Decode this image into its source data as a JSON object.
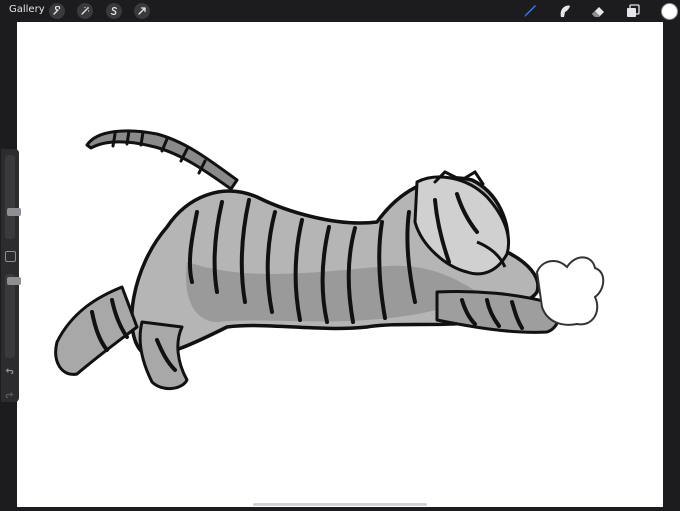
{
  "topbar": {
    "gallery_label": "Gallery",
    "left_tools": [
      {
        "name": "actions-wrench-icon"
      },
      {
        "name": "adjustments-magic-wand-icon"
      },
      {
        "name": "selection-s-icon"
      },
      {
        "name": "transform-arrow-icon"
      }
    ],
    "right_tools": [
      {
        "name": "brush-icon",
        "active": true
      },
      {
        "name": "smudge-icon"
      },
      {
        "name": "eraser-icon"
      },
      {
        "name": "layers-icon"
      }
    ],
    "active_color": "#ffffff",
    "accent_color": "#2f7cf6"
  },
  "sidebar": {
    "brush_size_level": 0.6,
    "opacity_level": 0.95,
    "modify_button_icon": "square-icon",
    "undo_icon": "undo-arrow-icon",
    "redo_icon": "redo-arrow-icon"
  },
  "canvas": {
    "background": "#ffffff",
    "artwork": "tiger-sketch"
  }
}
